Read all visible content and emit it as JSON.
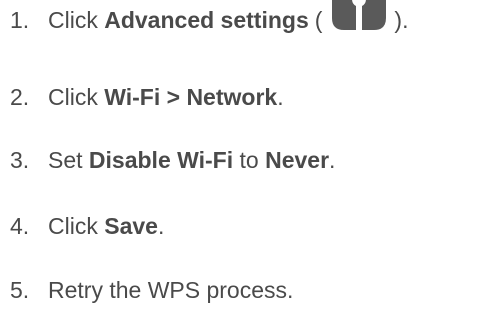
{
  "steps": [
    {
      "number": "1.",
      "verb": "Click",
      "target": "Advanced settings",
      "open_paren": "(",
      "close_paren_period": ").",
      "icon": "wrench-settings-icon"
    },
    {
      "number": "2.",
      "verb": "Click",
      "target": "Wi-Fi > Network",
      "end": "."
    },
    {
      "number": "3.",
      "verb": "Set",
      "target": "Disable Wi-Fi",
      "middle": "to",
      "value": "Never",
      "end": "."
    },
    {
      "number": "4.",
      "verb": "Click",
      "target": "Save",
      "end": "."
    },
    {
      "number": "5.",
      "text": "Retry the WPS process."
    }
  ],
  "colors": {
    "text": "#4a4a4a",
    "icon": "#5a5a5a"
  }
}
